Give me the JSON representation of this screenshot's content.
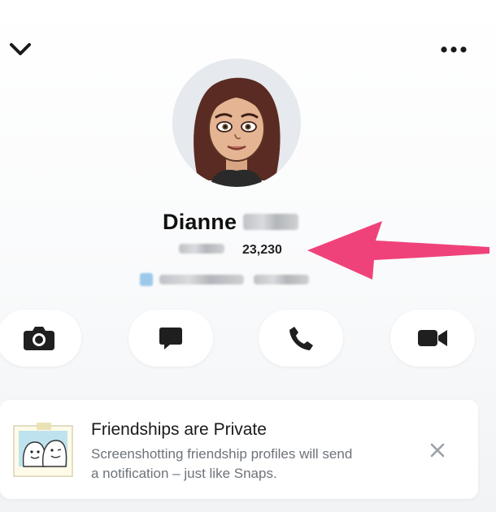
{
  "profile": {
    "name": "Dianne",
    "snap_score": "23,230"
  },
  "top_bar": {
    "back_icon": "chevron-down-icon",
    "more_icon": "ellipsis-icon"
  },
  "actions": [
    {
      "icon": "camera-icon"
    },
    {
      "icon": "chat-icon"
    },
    {
      "icon": "phone-icon"
    },
    {
      "icon": "video-icon"
    }
  ],
  "friendship_card": {
    "title": "Friendships are Private",
    "body_line1": "Screenshotting friendship profiles will send",
    "body_line2": "a notification – just like Snaps.",
    "close_icon": "close-icon"
  },
  "colors": {
    "accent_arrow": "#f0427a",
    "text_primary": "#111111",
    "text_secondary": "#6d737a",
    "button_bg": "#ffffff",
    "page_bg": "#f7f8fa"
  }
}
